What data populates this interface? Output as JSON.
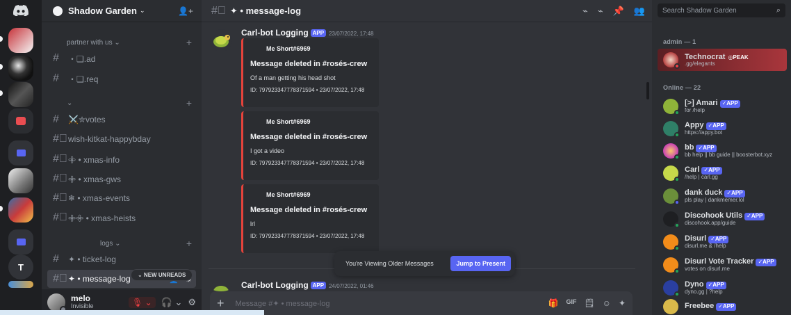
{
  "colors": {
    "rail": "#1e1f22",
    "sidebar": "#2b2d31",
    "chat": "#313338",
    "blurple": "#5865f2",
    "embed_border": "#e5433b",
    "online": "#23a55a"
  },
  "rail": {
    "items": [
      {
        "icon": "discord-logo-icon"
      },
      {
        "icon": "server-icon"
      },
      {
        "icon": "server-icon"
      },
      {
        "icon": "server-icon"
      },
      {
        "icon": "server-icon"
      },
      {
        "icon": "folder-icon"
      },
      {
        "icon": "server-icon"
      },
      {
        "icon": "server-icon"
      },
      {
        "icon": "folder-icon"
      },
      {
        "label": "T"
      }
    ]
  },
  "guild": {
    "name": "Shadow Garden",
    "chevron": "⌄",
    "invite": "👤+"
  },
  "categories": [
    {
      "label": "partner with us ⌄",
      "plus": "+"
    },
    {
      "label": "⌄",
      "plus": "+"
    },
    {
      "label": "logs ⌄",
      "plus": "+"
    }
  ],
  "channels": [
    {
      "hash": "#",
      "name": "・❏.ad"
    },
    {
      "hash": "#",
      "name": "・❏.req"
    },
    {
      "hash": "#",
      "name": "⚔️✮votes"
    },
    {
      "hash": "#⃨",
      "name": "wish-kitkat-happybday"
    },
    {
      "hash": "#⃨",
      "name": "𖧷 • xmas-info"
    },
    {
      "hash": "#⃨",
      "name": "𖧷 • xmas-gws"
    },
    {
      "hash": "#⃨",
      "name": "❄ • xmas-events"
    },
    {
      "hash": "#⃨",
      "name": "𖧷𖧷 • xmas-heists"
    },
    {
      "hash": "#",
      "name": "✦ • ticket-log"
    },
    {
      "hash": "#⃨",
      "name": "✦ • message-log",
      "actions": "👤+ ⚙"
    }
  ],
  "new_unreads": "⌄ NEW UNREADS",
  "user": {
    "name": "melo",
    "status": "Invisible",
    "mute": "🎙 ⌄",
    "headset": "🎧 ⌄",
    "settings": "⚙"
  },
  "chat_header": {
    "hash": "#⃨",
    "title": "✦ • message-log",
    "tools": [
      "⌁",
      "⌁",
      "📌",
      "👥"
    ]
  },
  "messages": [
    {
      "author": "Carl-bot Logging",
      "tag": "APP",
      "time": "23/07/2022, 17:48"
    },
    {
      "author": "Carl-bot Logging",
      "tag": "APP",
      "time": "24/07/2022, 01:46"
    }
  ],
  "embeds": [
    {
      "author": "Me Short#6969",
      "title": "Message deleted in #rosés-crew",
      "desc": "Of a man getting his head shot",
      "footer": "ID: 797923347778371594 • 23/07/2022, 17:48"
    },
    {
      "author": "Me Short#6969",
      "title": "Message deleted in #rosés-crew",
      "desc": "I got a video",
      "footer": "ID: 797923347778371594 • 23/07/2022, 17:48"
    },
    {
      "author": "Me Short#6969",
      "title": "Message deleted in #rosés-crew",
      "desc": "lrl",
      "footer": "ID: 797923347778371594 • 23/07/2022, 17:48"
    }
  ],
  "older": {
    "text": "You're Viewing Older Messages",
    "button": "Jump to Present"
  },
  "composer": {
    "plus": "+",
    "placeholder": "Message #✦ • message-log",
    "tools": [
      "🎁",
      "GIF",
      "🗒",
      "☺",
      "✦"
    ]
  },
  "members": {
    "search_placeholder": "Search Shadow Garden",
    "search_icon": "⌕",
    "roles": [
      {
        "label": "admin — 1"
      },
      {
        "label": "Online — 22"
      }
    ],
    "list": [
      {
        "name": "Technocrat",
        "badge": "◎PEAK",
        "sub": ".gg/elegants",
        "highlight": true
      },
      {
        "name": "[>] Amari",
        "badge": "✓APP",
        "sub": "for /help"
      },
      {
        "name": "Appy",
        "badge": "✓APP",
        "sub": "https://appy.bot"
      },
      {
        "name": "bb",
        "badge": "✓APP",
        "sub": "bb help || bb guide || boosterbot.xyz"
      },
      {
        "name": "Carl",
        "badge": "✓APP",
        "sub": "/help | carl.gg"
      },
      {
        "name": "dank duck",
        "badge": "✓APP",
        "sub": "pls play | dankmemer.lol"
      },
      {
        "name": "Discohook Utils",
        "badge": "✓APP",
        "sub": "discohook.app/guide"
      },
      {
        "name": "Disurl",
        "badge": "✓APP",
        "sub": "disurl.me & /help"
      },
      {
        "name": "Disurl Vote Tracker",
        "badge": "✓APP",
        "sub": "votes on disurl.me"
      },
      {
        "name": "Dyno",
        "badge": "✓APP",
        "sub": "dyno.gg | ?help"
      },
      {
        "name": "Freebee",
        "badge": "✓APP",
        "sub": ""
      }
    ]
  }
}
